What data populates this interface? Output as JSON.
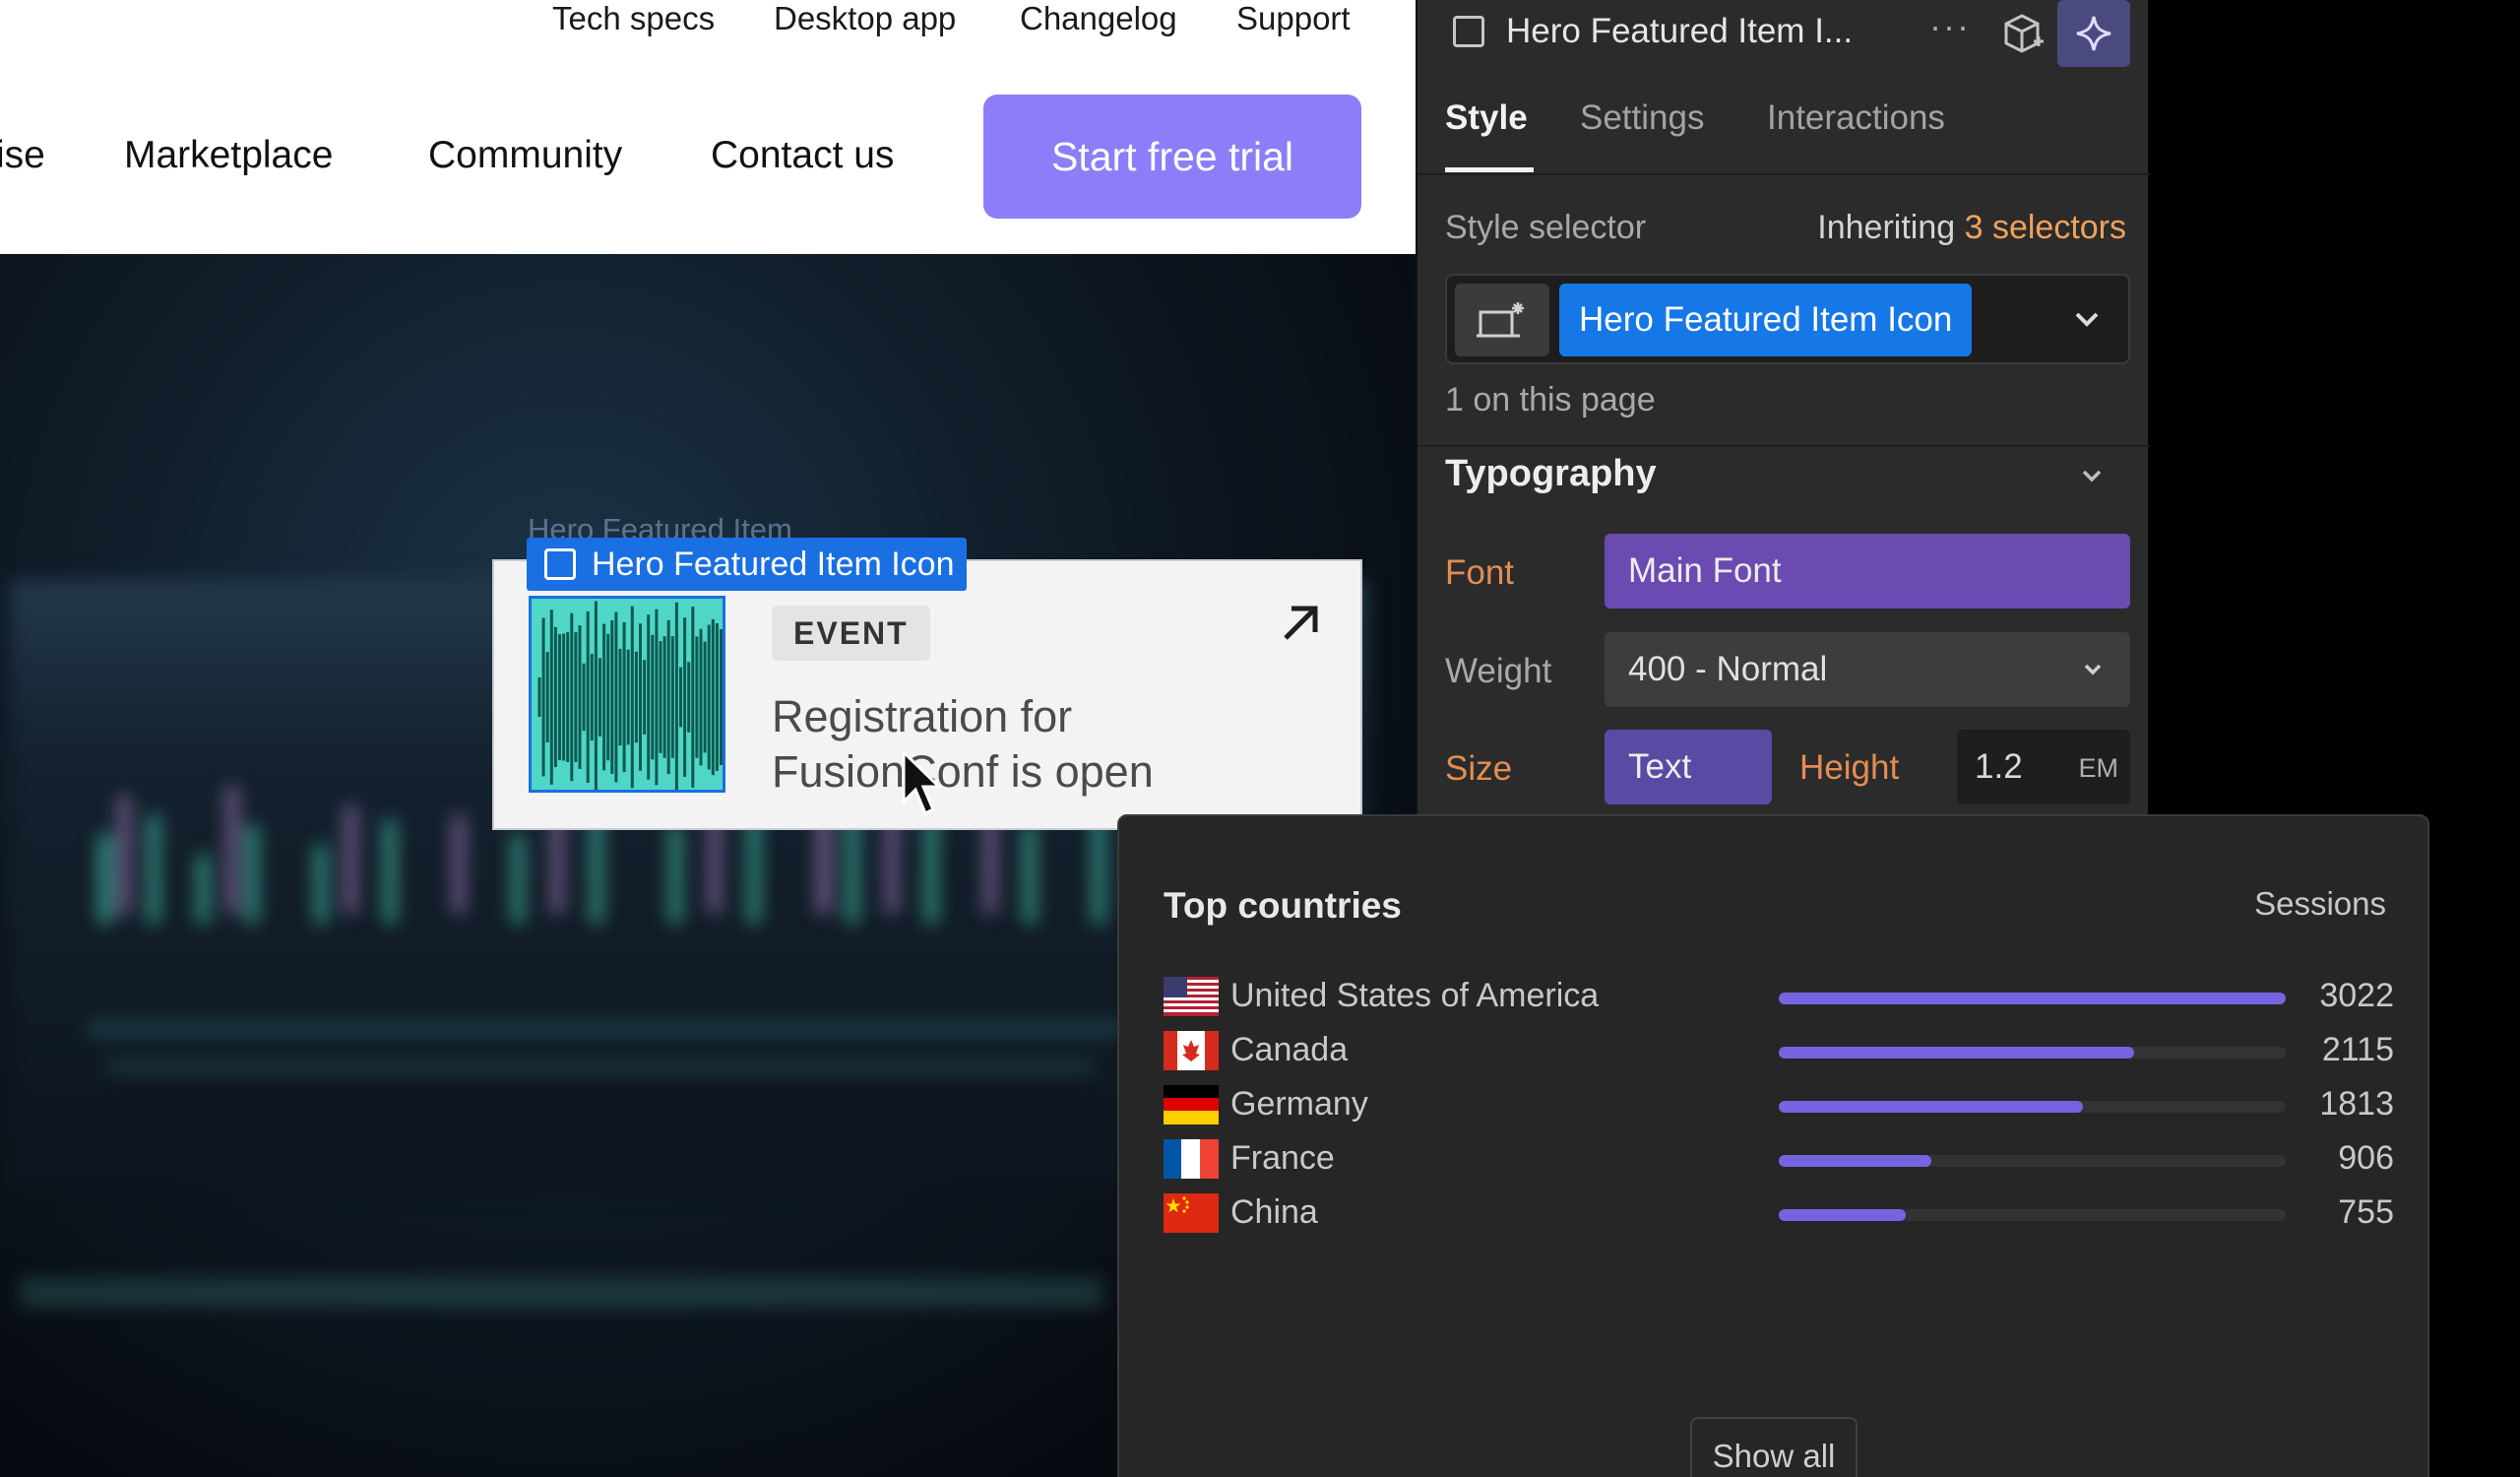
{
  "site": {
    "top_links": [
      "Tech specs",
      "Desktop app",
      "Changelog",
      "Support"
    ],
    "nav_links": [
      "ise",
      "Marketplace",
      "Community",
      "Contact us"
    ],
    "cta_label": "Start free trial",
    "selected_ghost_label": "Hero Featured Item",
    "selected_tag_label": "Hero Featured Item Icon",
    "card": {
      "badge": "EVENT",
      "title": "Registration for FusionConf is open"
    }
  },
  "panel": {
    "element_title": "Hero Featured Item I...",
    "more_label": "···",
    "tabs": [
      "Style",
      "Settings",
      "Interactions"
    ],
    "active_tab": "Style",
    "style_selector_label": "Style selector",
    "inheriting_prefix": "Inheriting",
    "inheriting_count": "3 selectors",
    "selector_chip": "Hero Featured Item Icon",
    "on_page_text": "1 on this page",
    "typography": {
      "heading": "Typography",
      "font_label": "Font",
      "font_value": "Main Font",
      "weight_label": "Weight",
      "weight_value": "400 - Normal",
      "size_label": "Size",
      "size_value": "Text",
      "height_label": "Height",
      "height_value": "1.2",
      "height_unit": "EM"
    },
    "colors": {
      "accent_purple": "#8b7ef8",
      "selection_blue": "#1677e6",
      "label_orange": "#e38d52"
    }
  },
  "countries": {
    "title": "Top countries",
    "metric": "Sessions",
    "show_all": "Show all",
    "bar_color": "#7564e0",
    "rows": [
      {
        "name": "United States of America",
        "flag": "us-flag",
        "value": "3022",
        "fraction": 1.0
      },
      {
        "name": "Canada",
        "flag": "canada-flag",
        "value": "2115",
        "fraction": 0.7
      },
      {
        "name": "Germany",
        "flag": "germany-flag",
        "value": "1813",
        "fraction": 0.6
      },
      {
        "name": "France",
        "flag": "france-flag",
        "value": "906",
        "fraction": 0.3
      },
      {
        "name": "China",
        "flag": "china-flag",
        "value": "755",
        "fraction": 0.25
      }
    ]
  }
}
